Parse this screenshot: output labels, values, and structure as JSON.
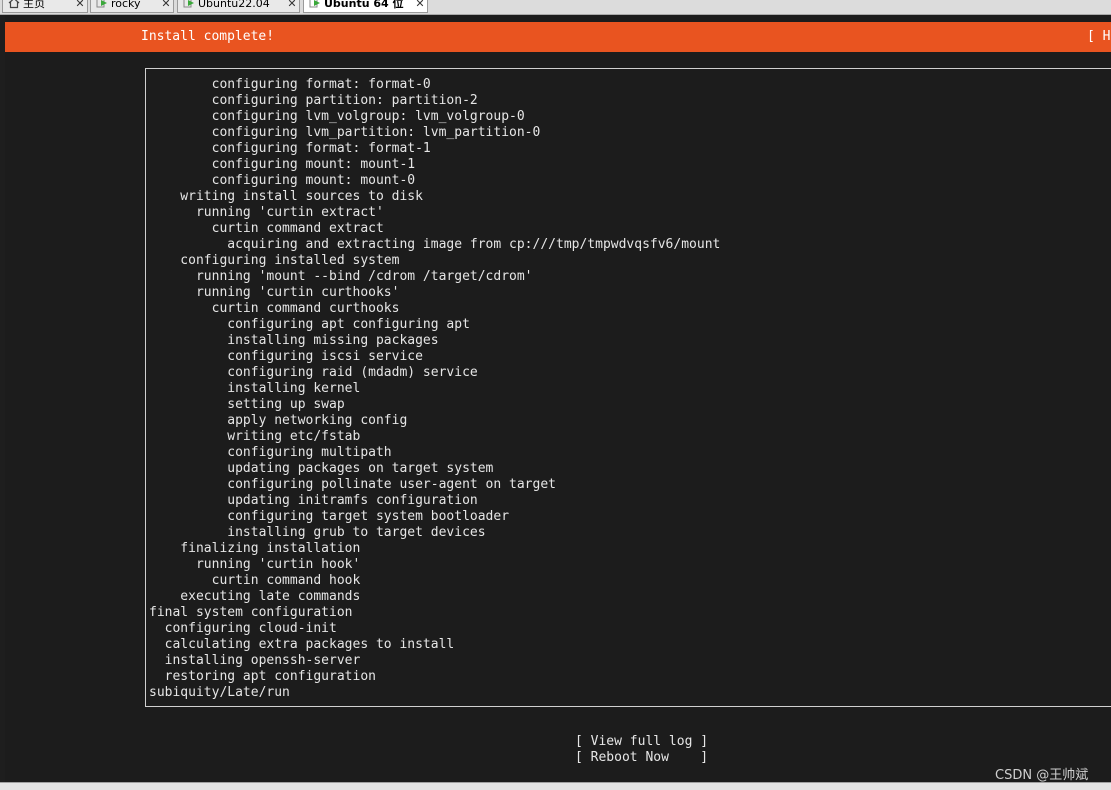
{
  "tabs": [
    {
      "label": "主页",
      "icon": "home-icon",
      "active": false
    },
    {
      "label": "rocky",
      "icon": "vm-icon",
      "active": false
    },
    {
      "label": "Ubuntu22.04",
      "icon": "vm-icon",
      "active": false
    },
    {
      "label": "Ubuntu 64 位",
      "icon": "vm-icon",
      "active": true
    }
  ],
  "tab_close": "✕",
  "header": {
    "title": "Install complete!",
    "help": "[ He"
  },
  "log_lines": [
    "        configuring format: format-0",
    "        configuring partition: partition-2",
    "        configuring lvm_volgroup: lvm_volgroup-0",
    "        configuring lvm_partition: lvm_partition-0",
    "        configuring format: format-1",
    "        configuring mount: mount-1",
    "        configuring mount: mount-0",
    "    writing install sources to disk",
    "      running 'curtin extract'",
    "        curtin command extract",
    "          acquiring and extracting image from cp:///tmp/tmpwdvqsfv6/mount",
    "    configuring installed system",
    "      running 'mount --bind /cdrom /target/cdrom'",
    "      running 'curtin curthooks'",
    "        curtin command curthooks",
    "          configuring apt configuring apt",
    "          installing missing packages",
    "          configuring iscsi service",
    "          configuring raid (mdadm) service",
    "          installing kernel",
    "          setting up swap",
    "          apply networking config",
    "          writing etc/fstab",
    "          configuring multipath",
    "          updating packages on target system",
    "          configuring pollinate user-agent on target",
    "          updating initramfs configuration",
    "          configuring target system bootloader",
    "          installing grub to target devices",
    "    finalizing installation",
    "      running 'curtin hook'",
    "        curtin command hook",
    "    executing late commands",
    "final system configuration",
    "  configuring cloud-init",
    "  calculating extra packages to install",
    "  installing openssh-server",
    "  restoring apt configuration",
    "subiquity/Late/run"
  ],
  "buttons": {
    "view_full_log": "[ View full log ]",
    "reboot_now": "[ Reboot Now    ]"
  },
  "watermark": "CSDN @王帅斌",
  "colors": {
    "header": "#e95420",
    "terminal_bg": "#1c1c1c",
    "text": "#e6e6e6"
  }
}
